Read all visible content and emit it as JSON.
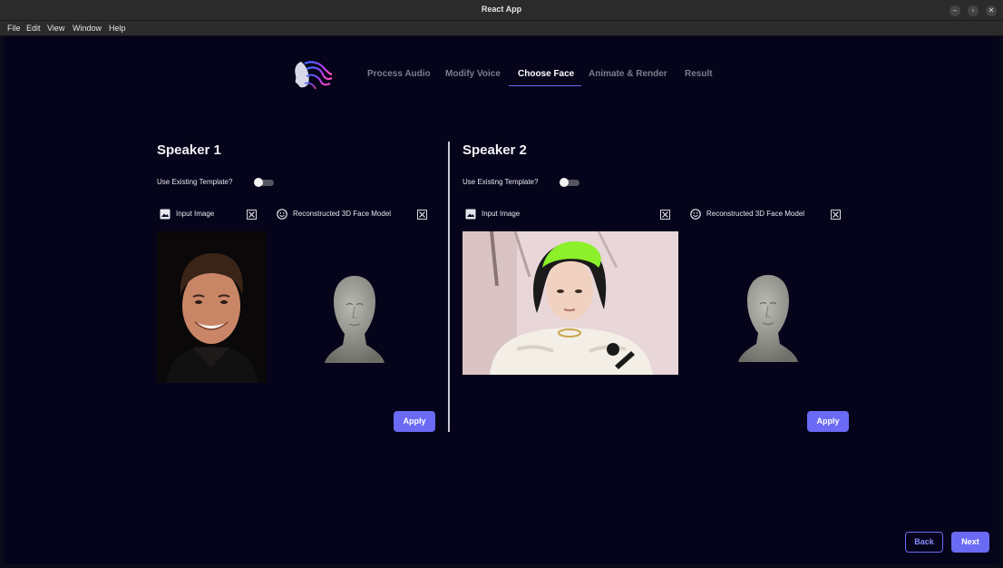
{
  "window": {
    "title": "React App"
  },
  "menu": [
    "File",
    "Edit",
    "View",
    "Window",
    "Help"
  ],
  "nav": {
    "tabs": [
      "Process Audio",
      "Modify Voice",
      "Choose Face",
      "Animate & Render",
      "Result"
    ],
    "active": "Choose Face"
  },
  "speakers": [
    {
      "title": "Speaker 1",
      "template_label": "Use Existing Template?",
      "template_enabled": false,
      "input_label": "Input Image",
      "model_label": "Reconstructed 3D Face Model",
      "apply_label": "Apply"
    },
    {
      "title": "Speaker 2",
      "template_label": "Use Existing Template?",
      "template_enabled": false,
      "input_label": "Input Image",
      "model_label": "Reconstructed 3D Face Model",
      "apply_label": "Apply"
    }
  ],
  "footer": {
    "back_label": "Back",
    "next_label": "Next"
  },
  "colors": {
    "accent": "#6a6af4",
    "background": "#05041a"
  }
}
